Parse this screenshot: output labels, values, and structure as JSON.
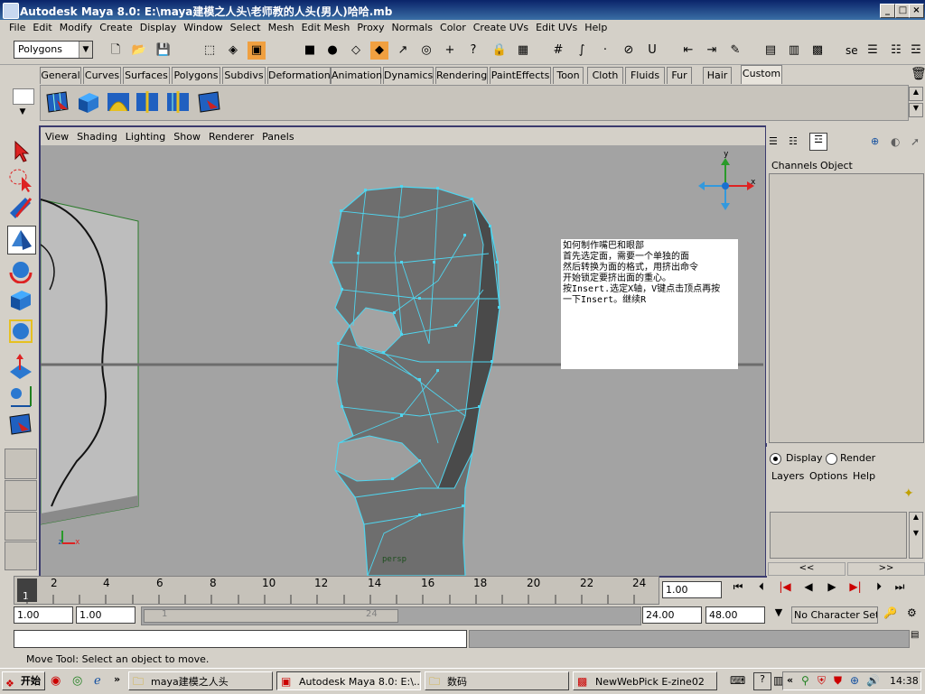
{
  "window": {
    "title": "Autodesk Maya 8.0: E:\\maya建模之人头\\老师教的人头(男人)哈哈.mb",
    "minimize": "_",
    "maximize": "□",
    "close": "×"
  },
  "menubar": [
    "File",
    "Edit",
    "Modify",
    "Create",
    "Display",
    "Window",
    "Select",
    "Mesh",
    "Edit Mesh",
    "Proxy",
    "Normals",
    "Color",
    "Create UVs",
    "Edit UVs",
    "Help"
  ],
  "statusline": {
    "mode": "Polygons",
    "se_label": "se"
  },
  "shelf_tabs": [
    "General",
    "Curves",
    "Surfaces",
    "Polygons",
    "Subdivs",
    "Deformation",
    "Animation",
    "Dynamics",
    "Rendering",
    "PaintEffects",
    "Toon",
    "Cloth",
    "Fluids",
    "Fur",
    "Hair",
    "Custom"
  ],
  "active_shelf_tab": "Custom",
  "viewport": {
    "menu": [
      "View",
      "Shading",
      "Lighting",
      "Show",
      "Renderer",
      "Panels"
    ],
    "camera_label": "persp",
    "axis_y": "y",
    "axis_x": "x",
    "axis_z": "z",
    "note_text": "如何制作嘴巴和眼部\n首先选定面，需要一个单独的面\n然后转换为面的格式，用挤出命令\n开始锁定要挤出面的重心。\n按Insert.选定X轴，V键点击顶点再按\n一下Insert。继续R"
  },
  "channel_box": {
    "menu": [
      "Channels",
      "Object"
    ]
  },
  "layer_editor": {
    "display_label": "Display",
    "render_label": "Render",
    "menu": [
      "Layers",
      "Options",
      "Help"
    ],
    "prev": "<<",
    "next": ">>"
  },
  "time_slider": {
    "labels": [
      "2",
      "4",
      "6",
      "8",
      "10",
      "12",
      "14",
      "16",
      "18",
      "20",
      "22",
      "24"
    ],
    "current_frame": "1",
    "current_time_field": "1.00"
  },
  "range_slider": {
    "start_time": "1.00",
    "start_range": "1.00",
    "range_inner_start": "1",
    "range_inner_end": "24",
    "end_range": "24.00",
    "end_time": "48.00",
    "character_set": "No Character Set"
  },
  "help_line": "Move Tool: Select an object to move.",
  "taskbar": {
    "start": "开始",
    "buttons": [
      "maya建模之人头",
      "Autodesk Maya 8.0: E:\\...",
      "数码",
      "NewWebPick E-zine02"
    ],
    "chevron": "»",
    "tray_chevron": "«",
    "clock": "14:38"
  },
  "colors": {
    "title_start": "#0a246a",
    "viewport_bg": "#a3a3a3",
    "wire": "#4fd6f0",
    "mesh": "#6a6a6a"
  }
}
